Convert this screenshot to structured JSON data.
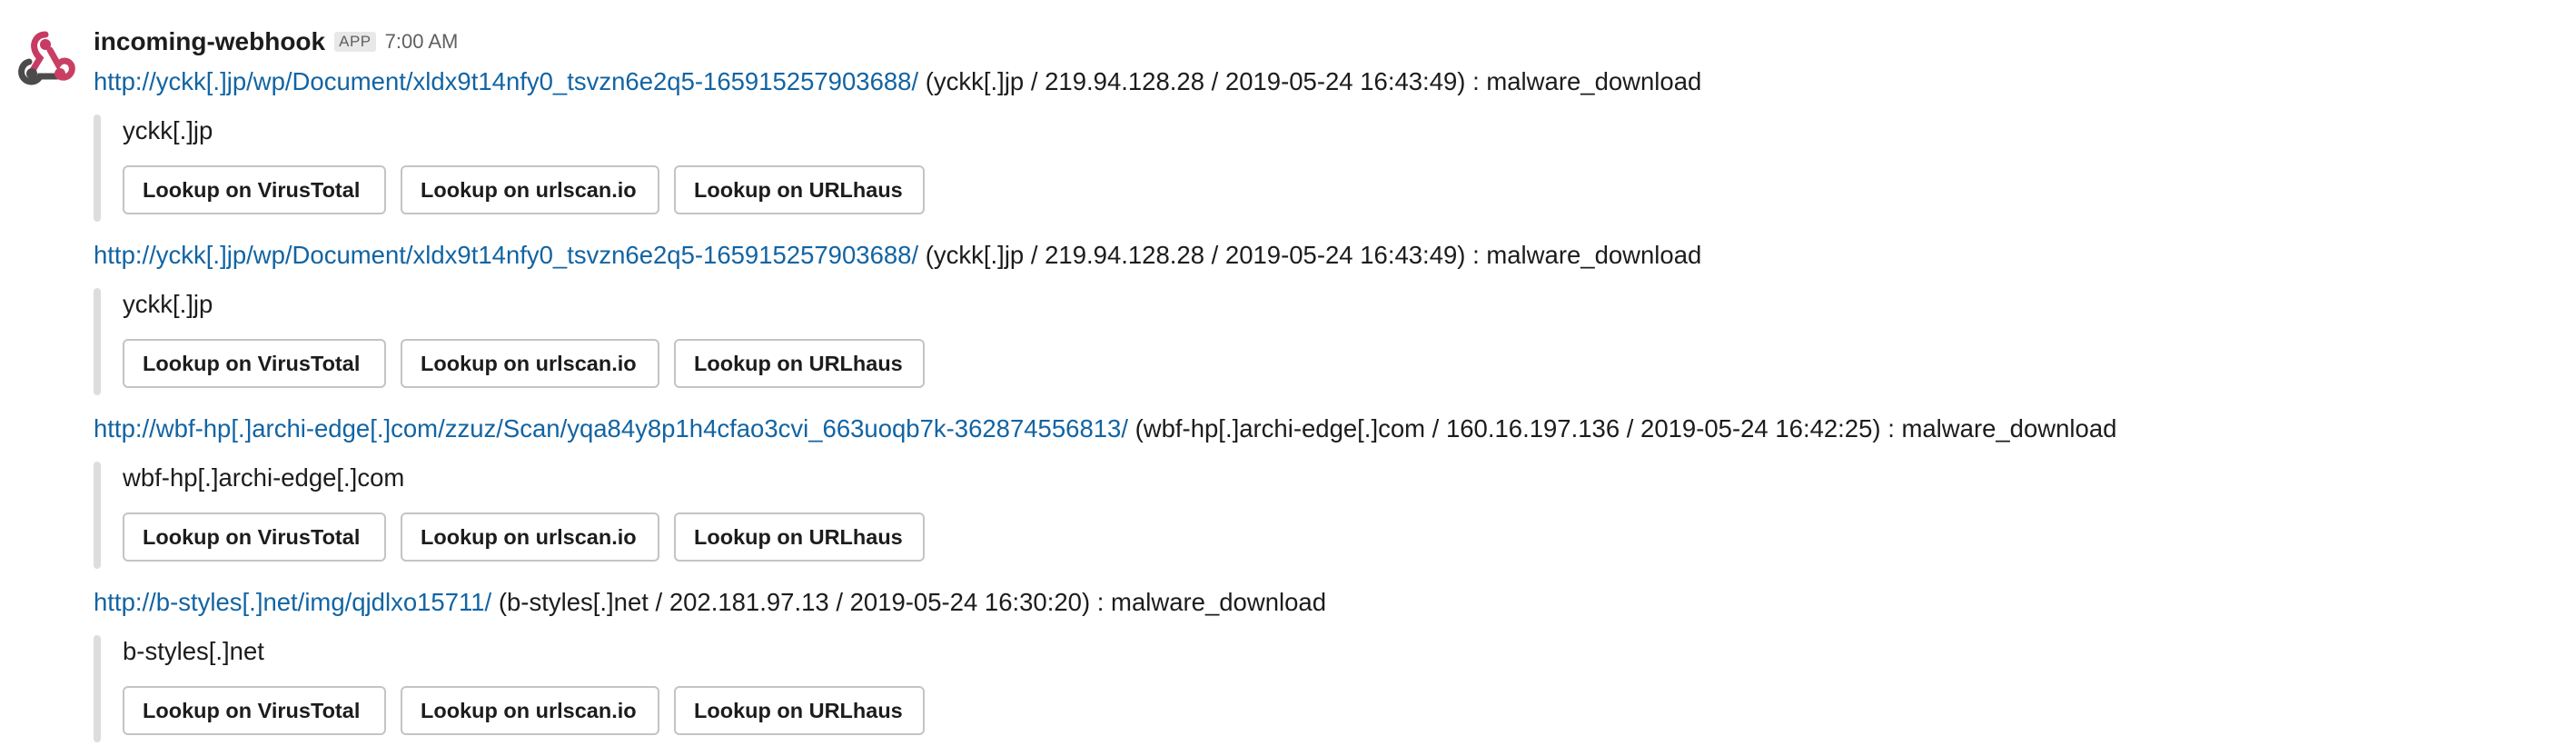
{
  "message": {
    "sender": "incoming-webhook",
    "badge": "APP",
    "timestamp": "7:00 AM",
    "icon": "webhook-icon",
    "colors": {
      "link": "#1264a3",
      "text": "#1d1c1d",
      "muted": "#616061",
      "attachment_bar": "#dddddd",
      "avatar_red": "#c73a63",
      "avatar_pink": "#c93f63",
      "avatar_dark": "#4b4b4b"
    }
  },
  "entries": [
    {
      "url": "http://yckk[.]jp/wp/Document/xldx9t14nfy0_tsvzn6e2q5-165915257903688/",
      "info": " (yckk[.]jp / 219.94.128.28 / 2019-05-24 16:43:49) : malware_download",
      "domain": "yckk[.]jp",
      "buttons": [
        "Lookup on VirusTotal",
        "Lookup on urlscan.io",
        "Lookup on URLhaus"
      ]
    },
    {
      "url": "http://yckk[.]jp/wp/Document/xldx9t14nfy0_tsvzn6e2q5-165915257903688/",
      "info": " (yckk[.]jp / 219.94.128.28 / 2019-05-24 16:43:49) : malware_download",
      "domain": "yckk[.]jp",
      "buttons": [
        "Lookup on VirusTotal",
        "Lookup on urlscan.io",
        "Lookup on URLhaus"
      ]
    },
    {
      "url": "http://wbf-hp[.]archi-edge[.]com/zzuz/Scan/yqa84y8p1h4cfao3cvi_663uoqb7k-362874556813/",
      "info": " (wbf-hp[.]archi-edge[.]com / 160.16.197.136 / 2019-05-24 16:42:25) : malware_download",
      "domain": "wbf-hp[.]archi-edge[.]com",
      "buttons": [
        "Lookup on VirusTotal",
        "Lookup on urlscan.io",
        "Lookup on URLhaus"
      ]
    },
    {
      "url": "http://b-styles[.]net/img/qjdlxo15711/",
      "info": " (b-styles[.]net / 202.181.97.13 / 2019-05-24 16:30:20) : malware_download",
      "domain": "b-styles[.]net",
      "buttons": [
        "Lookup on VirusTotal",
        "Lookup on urlscan.io",
        "Lookup on URLhaus"
      ]
    }
  ]
}
